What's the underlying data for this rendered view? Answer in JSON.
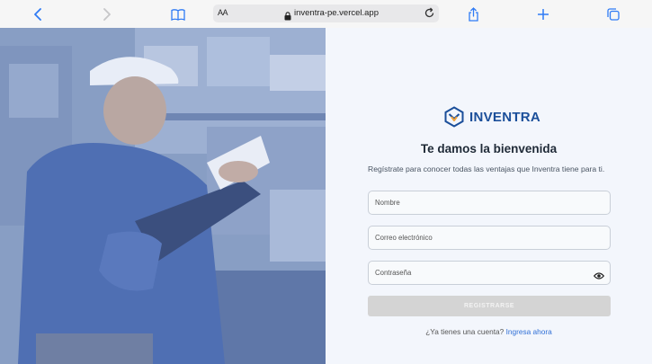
{
  "browser": {
    "text_size_label": "AA",
    "url": "inventra-pe.vercel.app",
    "icons": [
      "back-icon",
      "forward-icon",
      "bookmarks-icon",
      "lock-icon",
      "reload-icon",
      "share-icon",
      "new-tab-icon",
      "tabs-icon"
    ]
  },
  "brand": {
    "name": "INVENTRA",
    "color": "#1b4f9a",
    "accent": "#f2a33a"
  },
  "form": {
    "title": "Te damos la bienvenida",
    "subtitle": "Regístrate para conocer todas las ventajas que Inventra tiene para ti.",
    "name_placeholder": "Nombre",
    "email_placeholder": "Correo electrónico",
    "password_placeholder": "Contraseña",
    "submit_label": "REGISTRARSE",
    "have_account_text": "¿Ya tienes una cuenta?",
    "login_link_label": "Ingresa ahora"
  },
  "colors": {
    "panel_bg": "#f3f6fc",
    "button_disabled": "#d4d4d4",
    "link": "#2f6fd6"
  }
}
